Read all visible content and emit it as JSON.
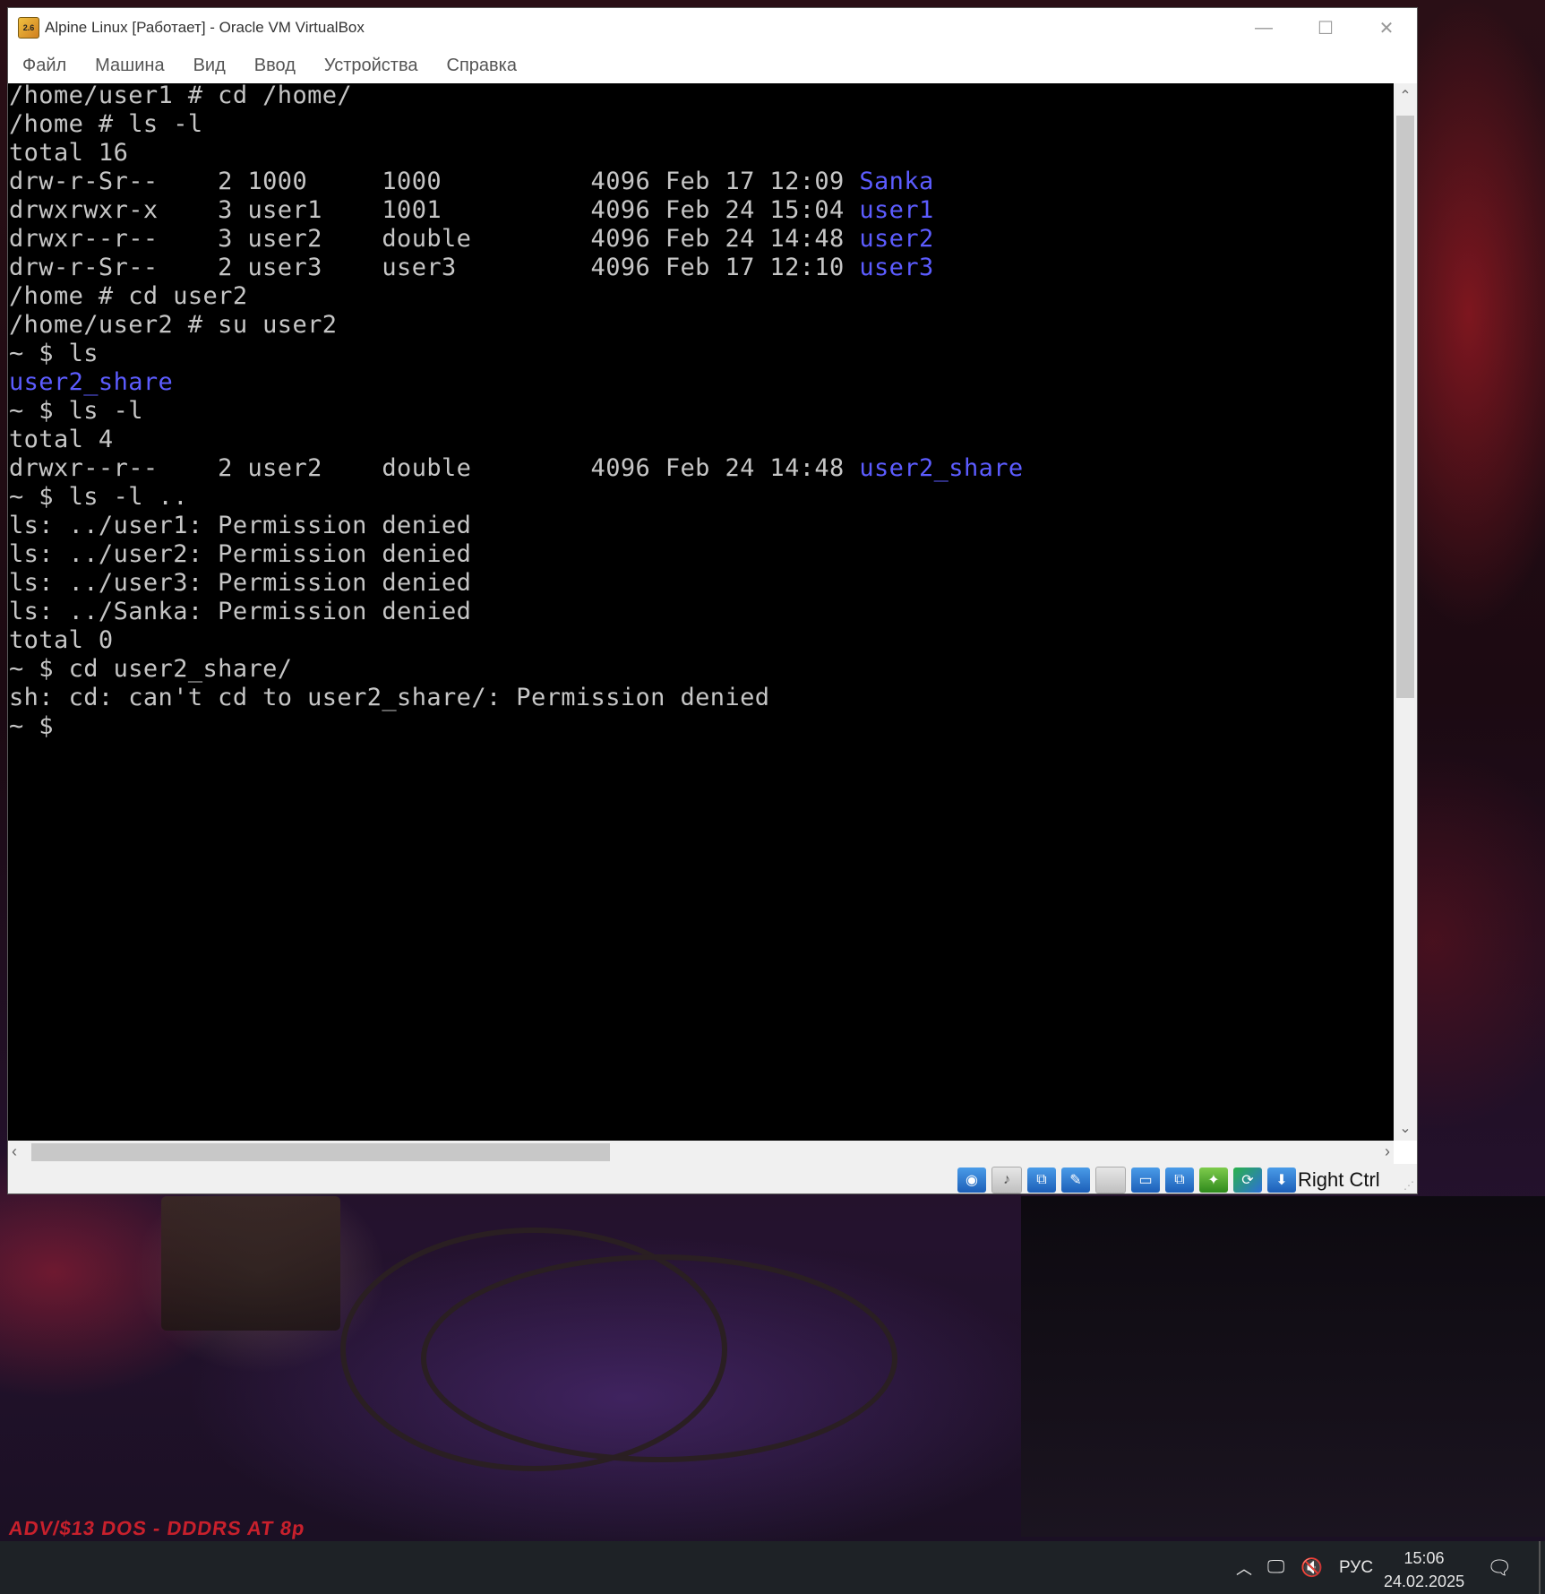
{
  "window": {
    "title": "Alpine Linux [Работает] - Oracle VM VirtualBox",
    "icon": "virtualbox-icon",
    "minimize": "—",
    "maximize": "☐",
    "close": "✕"
  },
  "menu": [
    "Файл",
    "Машина",
    "Вид",
    "Ввод",
    "Устройства",
    "Справка"
  ],
  "terminal": {
    "lines": [
      {
        "text": "/home/user1 # cd /home/",
        "color": "default"
      },
      {
        "text": "/home # ls -l",
        "color": "default"
      },
      {
        "text": "total 16",
        "color": "default"
      },
      {
        "text": "drw-r-Sr--    2 1000     1000          4096 Feb 17 12:09 ",
        "suffix": "Sanka"
      },
      {
        "text": "drwxrwxr-x    3 user1    1001          4096 Feb 24 15:04 ",
        "suffix": "user1"
      },
      {
        "text": "drwxr--r--    3 user2    double        4096 Feb 24 14:48 ",
        "suffix": "user2"
      },
      {
        "text": "drw-r-Sr--    2 user3    user3         4096 Feb 17 12:10 ",
        "suffix": "user3"
      },
      {
        "text": "/home # cd user2",
        "color": "default"
      },
      {
        "text": "/home/user2 # su user2",
        "color": "default"
      },
      {
        "text": "~ $ ls",
        "color": "default"
      },
      {
        "text": "",
        "suffix": "user2_share"
      },
      {
        "text": "~ $ ls -l",
        "color": "default"
      },
      {
        "text": "total 4",
        "color": "default"
      },
      {
        "text": "drwxr--r--    2 user2    double        4096 Feb 24 14:48 ",
        "suffix": "user2_share"
      },
      {
        "text": "~ $ ls -l ..",
        "color": "default"
      },
      {
        "text": "ls: ../user1: Permission denied",
        "color": "default"
      },
      {
        "text": "ls: ../user2: Permission denied",
        "color": "default"
      },
      {
        "text": "ls: ../user3: Permission denied",
        "color": "default"
      },
      {
        "text": "ls: ../Sanka: Permission denied",
        "color": "default"
      },
      {
        "text": "total 0",
        "color": "default"
      },
      {
        "text": "~ $ cd user2_share/",
        "color": "default"
      },
      {
        "text": "sh: cd: can't cd to user2_share/: Permission denied",
        "color": "default"
      },
      {
        "text": "~ $",
        "color": "default"
      }
    ],
    "directory_color": "#5c5cff",
    "text_color": "#c6c6c6"
  },
  "statusbar": {
    "icons": [
      "hard-disk-icon",
      "audio-icon",
      "network-icon",
      "usb-icon",
      "shared-folders-icon",
      "display-icon",
      "video-capture-icon",
      "mouse-integration-icon",
      "cpu-icon",
      "host-key-arrow-icon"
    ],
    "host_key": "Right Ctrl"
  },
  "wallpaper_text": "ADV/$13 DOS - DDDRS AT 8p",
  "taskbar": {
    "language": "РУС",
    "time": "15:06",
    "date": "24.02.2025"
  }
}
